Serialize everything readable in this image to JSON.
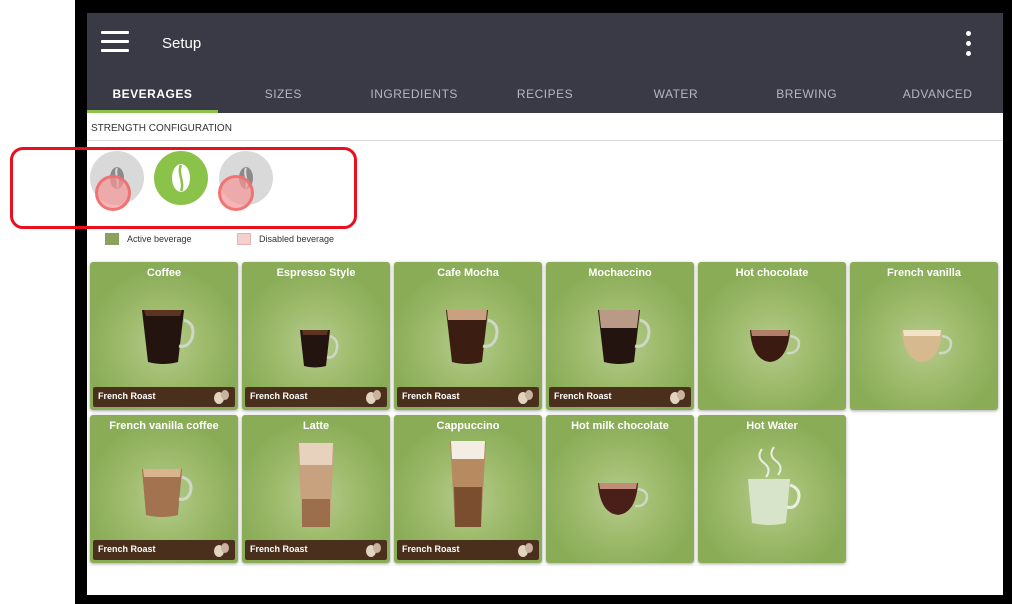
{
  "appbar": {
    "title": "Setup",
    "menu_icon": "hamburger-menu-icon",
    "more_icon": "vertical-dots-icon",
    "background": "#3a3a46"
  },
  "tabs": [
    {
      "label": "BEVERAGES",
      "active": true
    },
    {
      "label": "SIZES",
      "active": false
    },
    {
      "label": "INGREDIENTS",
      "active": false
    },
    {
      "label": "RECIPES",
      "active": false
    },
    {
      "label": "WATER",
      "active": false
    },
    {
      "label": "BREWING",
      "active": false
    },
    {
      "label": "ADVANCED",
      "active": false
    }
  ],
  "strength": {
    "section_label": "STRENGTH CONFIGURATION",
    "options": [
      {
        "state": "disabled",
        "icon": "coffee-bean-icon"
      },
      {
        "state": "active",
        "icon": "coffee-bean-icon"
      },
      {
        "state": "disabled",
        "icon": "coffee-bean-icon"
      }
    ]
  },
  "legend": {
    "active_label": "Active beverage",
    "active_color": "#8aa25e",
    "disabled_label": "Disabled beverage",
    "disabled_color": "#f6cfcf"
  },
  "beverages": [
    {
      "name": "Coffee",
      "strength_label": "French Roast",
      "has_strength": true
    },
    {
      "name": "Espresso Style",
      "strength_label": "French Roast",
      "has_strength": true
    },
    {
      "name": "Cafe Mocha",
      "strength_label": "French Roast",
      "has_strength": true
    },
    {
      "name": "Mochaccino",
      "strength_label": "French Roast",
      "has_strength": true
    },
    {
      "name": "Hot chocolate",
      "strength_label": "",
      "has_strength": false
    },
    {
      "name": "French vanilla",
      "strength_label": "",
      "has_strength": false
    },
    {
      "name": "French vanilla coffee",
      "strength_label": "French Roast",
      "has_strength": true
    },
    {
      "name": "Latte",
      "strength_label": "French Roast",
      "has_strength": true
    },
    {
      "name": "Cappuccino",
      "strength_label": "French Roast",
      "has_strength": true
    },
    {
      "name": "Hot milk chocolate",
      "strength_label": "",
      "has_strength": false
    },
    {
      "name": "Hot Water",
      "strength_label": "",
      "has_strength": false
    }
  ],
  "colors": {
    "accent": "#8bc34a",
    "tile": "#8aac57",
    "footer": "#4a2f1c",
    "annotation": "#e8101c"
  }
}
